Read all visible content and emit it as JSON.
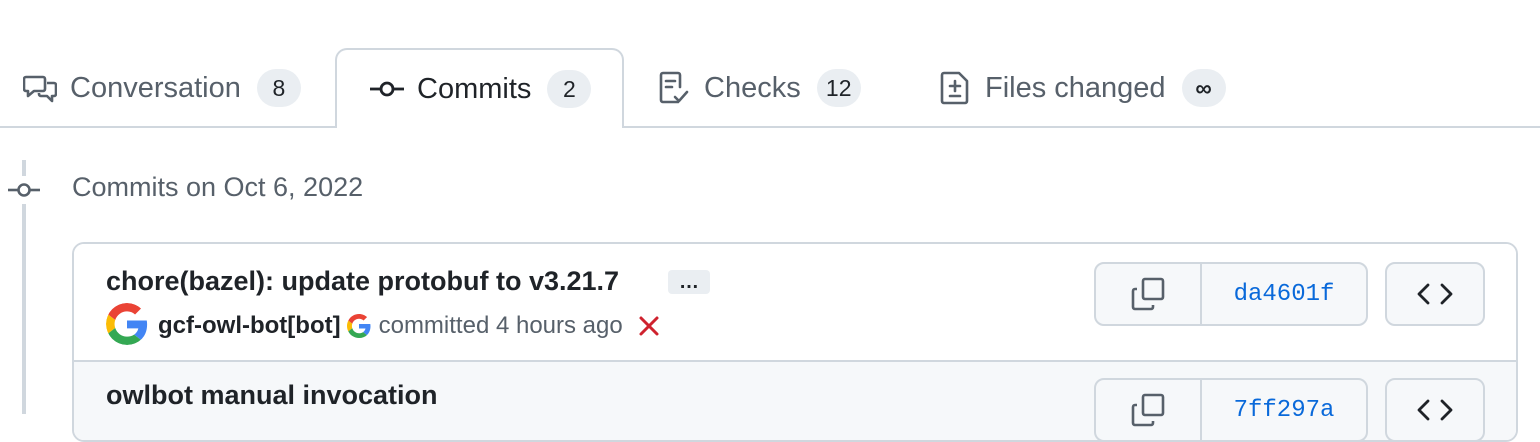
{
  "tabs": [
    {
      "label": "Conversation",
      "count": "8",
      "icon": "conversation-icon"
    },
    {
      "label": "Commits",
      "count": "2",
      "icon": "commit-icon",
      "selected": true
    },
    {
      "label": "Checks",
      "count": "12",
      "icon": "checks-icon"
    },
    {
      "label": "Files changed",
      "count": "∞",
      "icon": "file-diff-icon"
    }
  ],
  "timeline": {
    "date_heading": "Commits on Oct 6, 2022"
  },
  "commits": [
    {
      "title": "chore(bazel): update protobuf to v3.21.7",
      "ellipsis": "…",
      "author": "gcf-owl-bot[bot]",
      "meta_text": "committed 4 hours ago",
      "status": "failure",
      "sha": "da4601f"
    },
    {
      "title": "owlbot manual invocation",
      "sha": "7ff297a"
    }
  ],
  "colors": {
    "accent_link": "#0969da",
    "border": "#d0d7de",
    "muted_text": "#57606a",
    "counter_bg": "#eaeef2",
    "failure_red": "#cf222e"
  }
}
